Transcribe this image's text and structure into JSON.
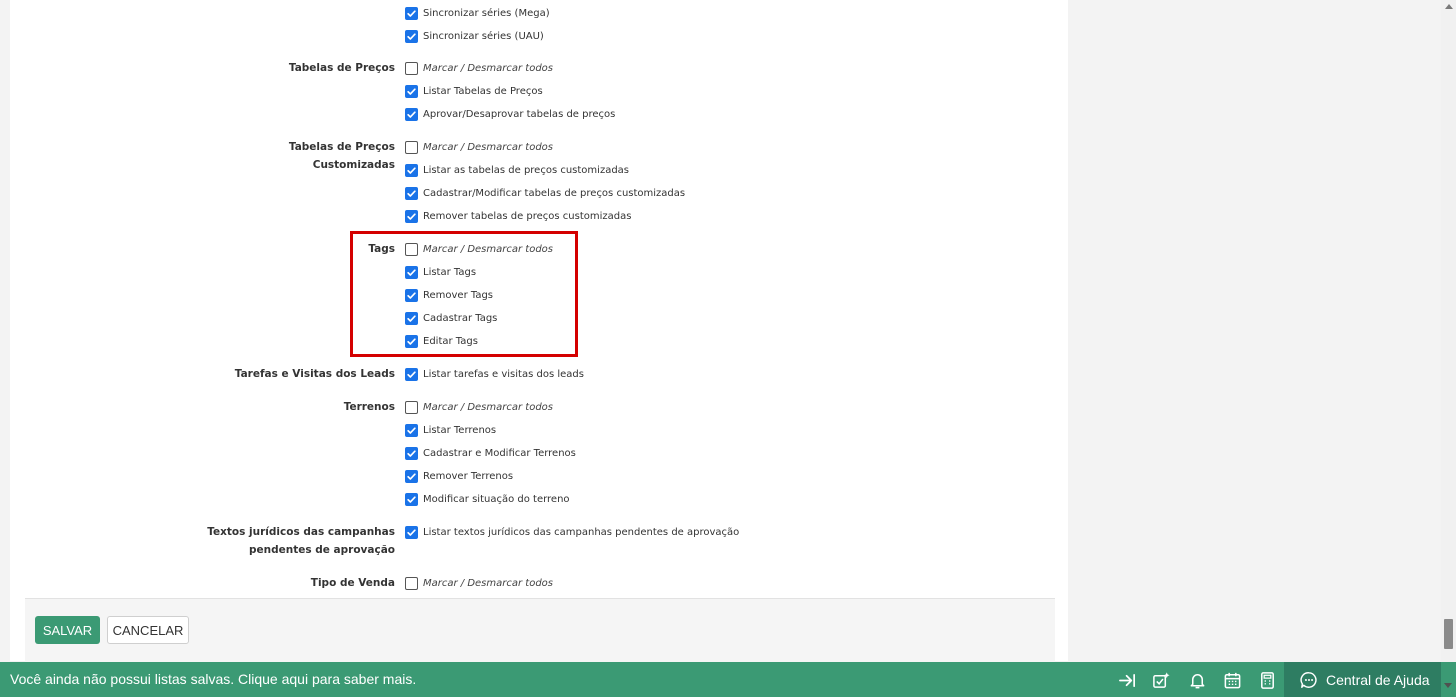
{
  "groups": [
    {
      "label": "",
      "items": [
        {
          "text": "Sincronizar séries (Mega)",
          "checked": true,
          "italic": false
        },
        {
          "text": "Sincronizar séries (UAU)",
          "checked": true,
          "italic": false
        }
      ]
    },
    {
      "label": "Tabelas de Preços",
      "items": [
        {
          "text": "Marcar / Desmarcar todos",
          "checked": false,
          "italic": true
        },
        {
          "text": "Listar Tabelas de Preços",
          "checked": true,
          "italic": false
        },
        {
          "text": "Aprovar/Desaprovar tabelas de preços",
          "checked": true,
          "italic": false
        }
      ]
    },
    {
      "label": "Tabelas de Preços Customizadas",
      "label_lines": [
        "Tabelas de Preços",
        "Customizadas"
      ],
      "items": [
        {
          "text": "Marcar / Desmarcar todos",
          "checked": false,
          "italic": true
        },
        {
          "text": "Listar as tabelas de preços customizadas",
          "checked": true,
          "italic": false
        },
        {
          "text": "Cadastrar/Modificar tabelas de preços customizadas",
          "checked": true,
          "italic": false
        },
        {
          "text": "Remover tabelas de preços customizadas",
          "checked": true,
          "italic": false
        }
      ]
    },
    {
      "label": "Tags",
      "items": [
        {
          "text": "Marcar / Desmarcar todos",
          "checked": false,
          "italic": true
        },
        {
          "text": "Listar Tags",
          "checked": true,
          "italic": false
        },
        {
          "text": "Remover Tags",
          "checked": true,
          "italic": false
        },
        {
          "text": "Cadastrar Tags",
          "checked": true,
          "italic": false
        },
        {
          "text": "Editar Tags",
          "checked": true,
          "italic": false
        }
      ]
    },
    {
      "label": "Tarefas e Visitas dos Leads",
      "items": [
        {
          "text": "Listar tarefas e visitas dos leads",
          "checked": true,
          "italic": false
        }
      ]
    },
    {
      "label": "Terrenos",
      "items": [
        {
          "text": "Marcar / Desmarcar todos",
          "checked": false,
          "italic": true
        },
        {
          "text": "Listar Terrenos",
          "checked": true,
          "italic": false
        },
        {
          "text": "Cadastrar e Modificar Terrenos",
          "checked": true,
          "italic": false
        },
        {
          "text": "Remover Terrenos",
          "checked": true,
          "italic": false
        },
        {
          "text": "Modificar situação do terreno",
          "checked": true,
          "italic": false
        }
      ]
    },
    {
      "label": "Textos jurídicos das campanhas pendentes de aprovação",
      "label_lines": [
        "Textos jurídicos das campanhas",
        "pendentes de aprovação"
      ],
      "items": [
        {
          "text": "Listar textos jurídicos das campanhas pendentes de aprovação",
          "checked": true,
          "italic": false
        }
      ]
    },
    {
      "label": "Tipo de Venda",
      "items": [
        {
          "text": "Marcar / Desmarcar todos",
          "checked": false,
          "italic": true
        }
      ]
    }
  ],
  "actions": {
    "save_label": "SALVAR",
    "cancel_label": "CANCELAR"
  },
  "footer": {
    "message": "Você ainda não possui listas salvas. Clique aqui para saber mais.",
    "help_label": "Central de Ajuda",
    "icons": [
      "collapse-arrow-icon",
      "new-task-icon",
      "bell-icon",
      "calendar-icon",
      "calculator-icon"
    ]
  },
  "colors": {
    "accent": "#3b9a74",
    "help_bg": "#2e7d62",
    "checkbox": "#1a73e8",
    "highlight": "#d40000"
  }
}
